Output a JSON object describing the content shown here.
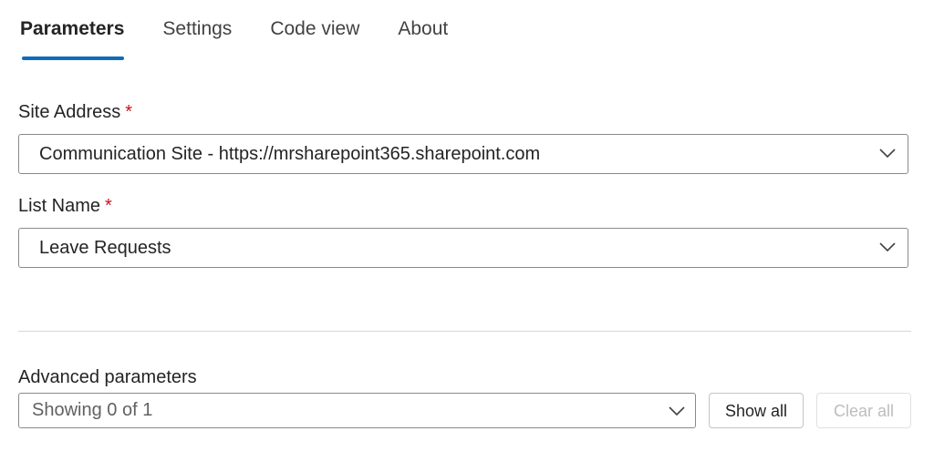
{
  "tabs": [
    {
      "label": "Parameters",
      "active": true
    },
    {
      "label": "Settings"
    },
    {
      "label": "Code view"
    },
    {
      "label": "About"
    }
  ],
  "fields": {
    "site_address": {
      "label": "Site Address",
      "required_mark": "*",
      "value": "Communication Site - https://mrsharepoint365.sharepoint.com"
    },
    "list_name": {
      "label": "List Name",
      "required_mark": "*",
      "value": "Leave Requests"
    }
  },
  "advanced": {
    "label": "Advanced parameters",
    "dropdown_value": "Showing 0 of 1",
    "show_all_label": "Show all",
    "clear_all_label": "Clear all"
  },
  "icons": {
    "dropdown": "chevron-down-icon"
  },
  "colors": {
    "accent": "#0f6cbd",
    "required": "#c50f1f",
    "border": "#8a8a8a",
    "divider": "#d6d6d6",
    "disabled_text": "#bdbdbd"
  }
}
